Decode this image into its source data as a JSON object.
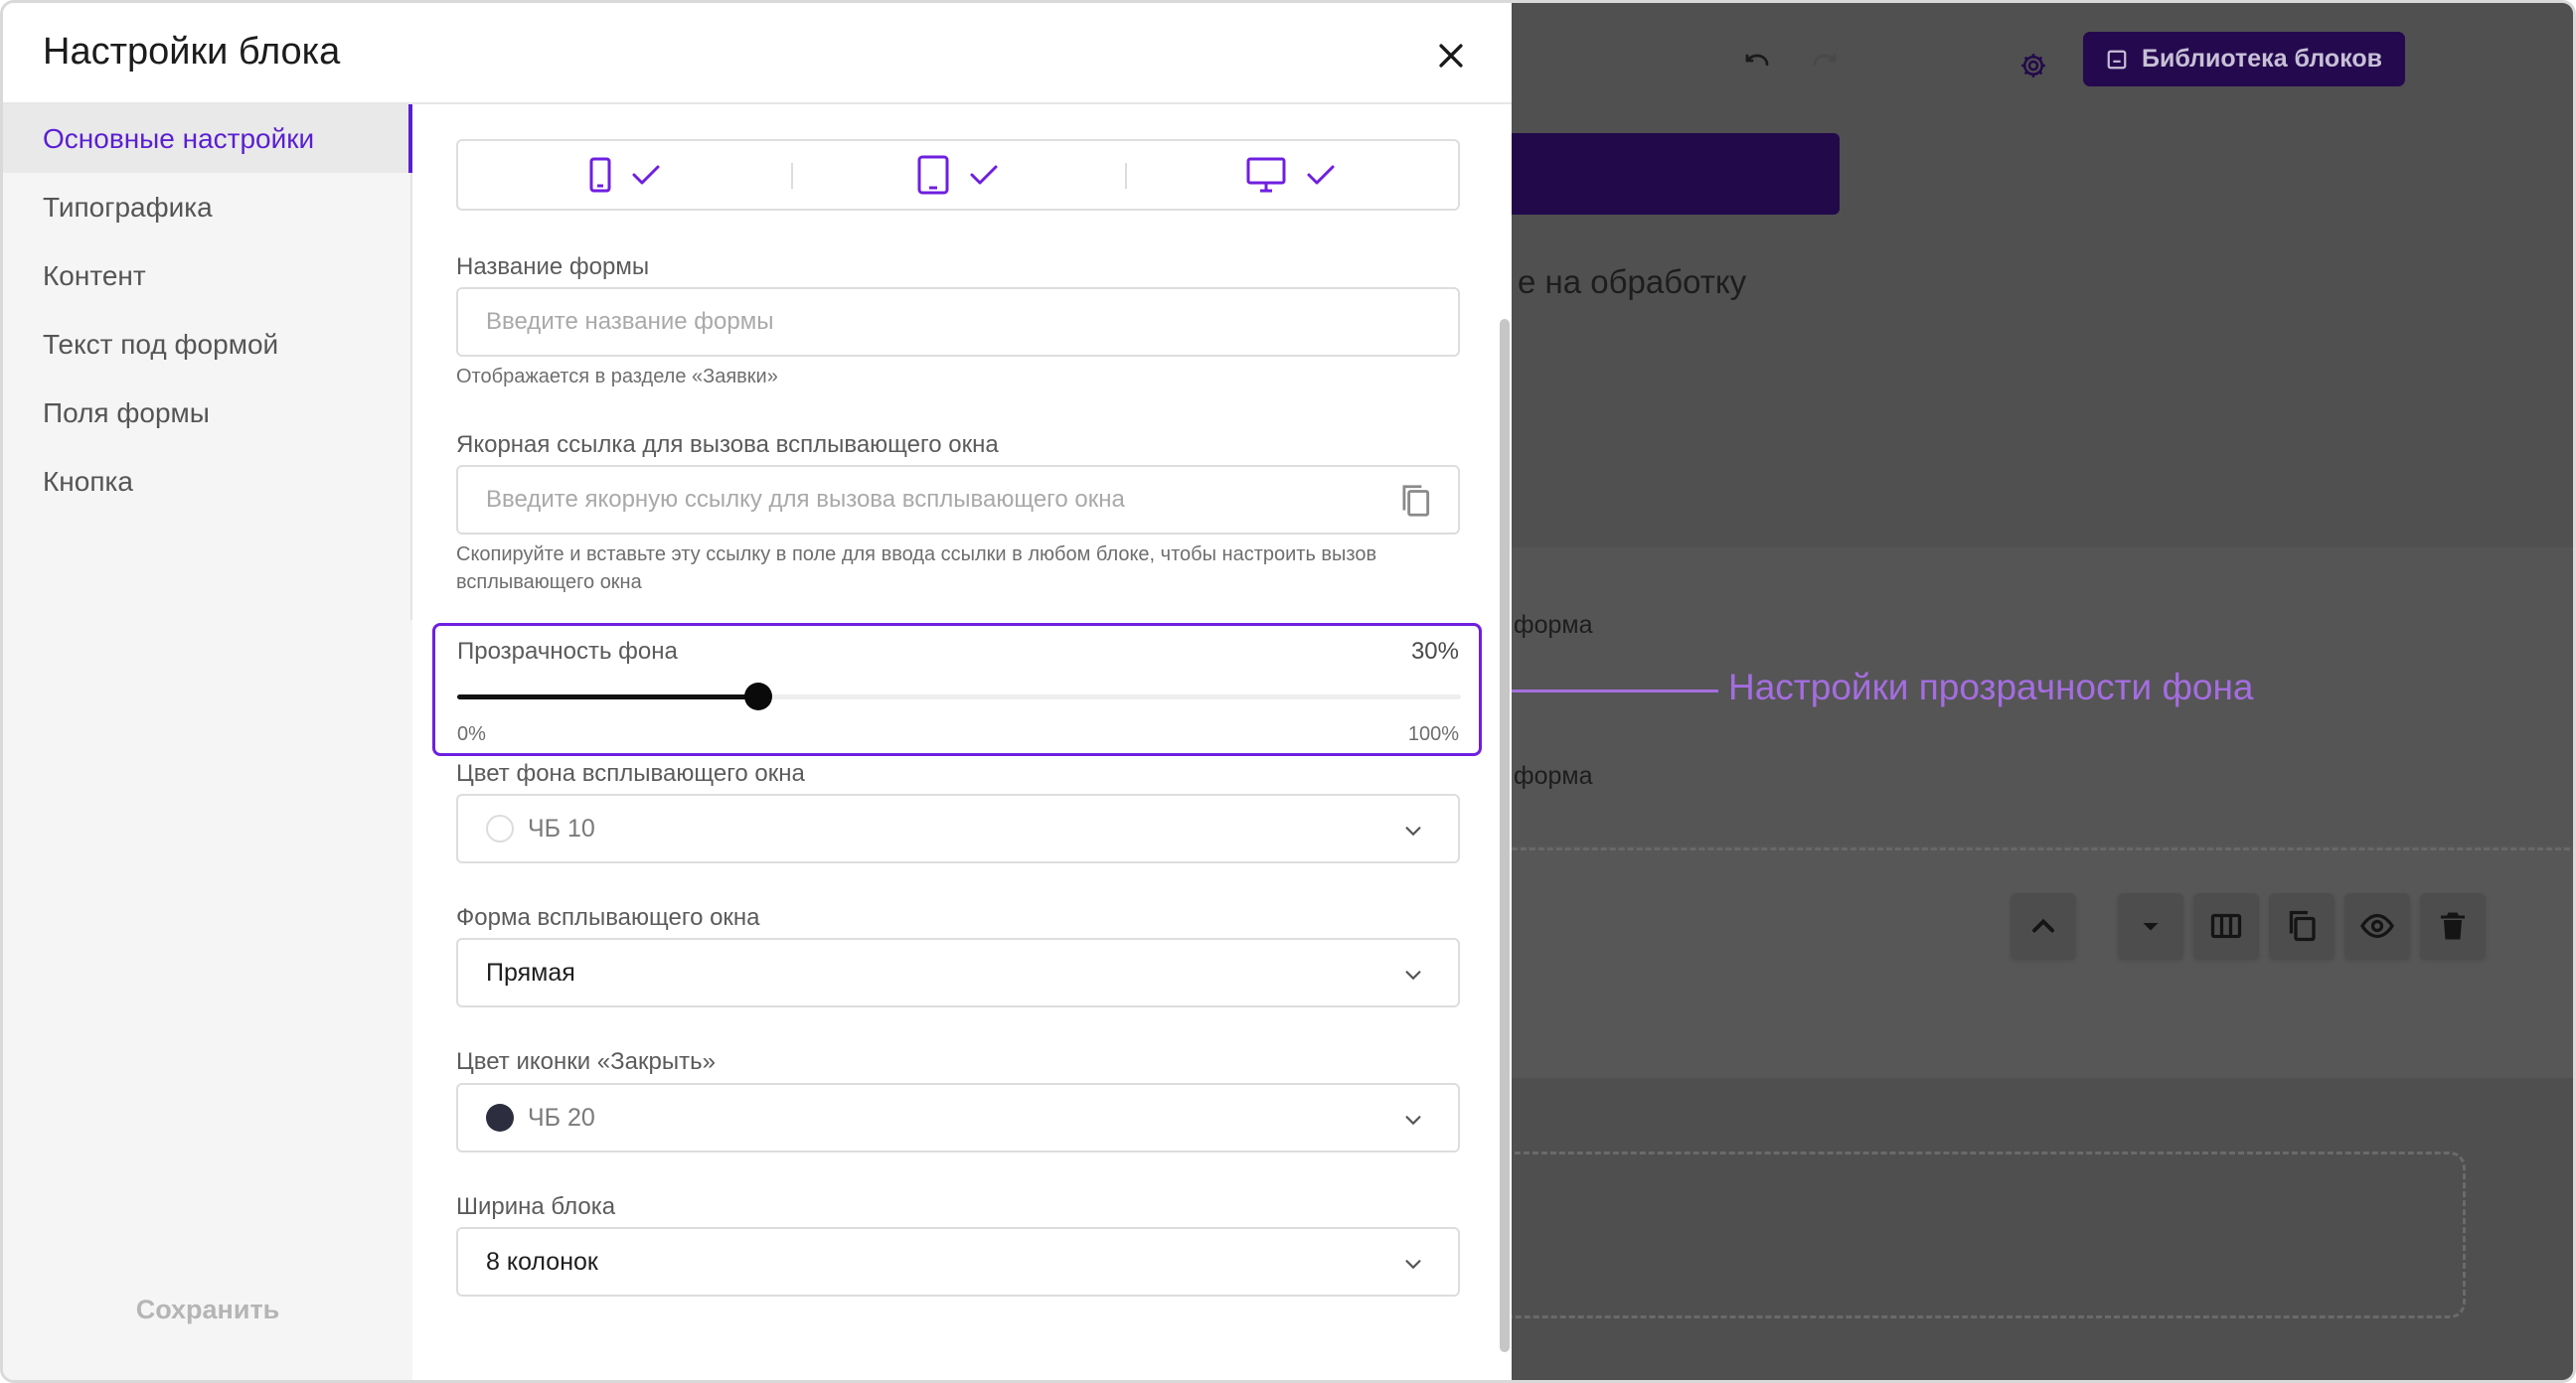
{
  "modal": {
    "title": "Настройки блока",
    "nav": [
      {
        "label": "Основные настройки",
        "active": true
      },
      {
        "label": "Типографика",
        "active": false
      },
      {
        "label": "Контент",
        "active": false
      },
      {
        "label": "Текст под формой",
        "active": false
      },
      {
        "label": "Поля формы",
        "active": false
      },
      {
        "label": "Кнопка",
        "active": false
      }
    ],
    "save_label": "Сохранить"
  },
  "devices": {
    "mobile_icon": "mobile-icon",
    "tablet_icon": "tablet-icon",
    "desktop_icon": "desktop-icon",
    "check_icon": "check-icon"
  },
  "form_name": {
    "label": "Название формы",
    "placeholder": "Введите название формы",
    "value": "",
    "hint": "Отображается в разделе «Заявки»"
  },
  "anchor": {
    "label": "Якорная ссылка для вызова всплывающего окна",
    "placeholder": "Введите якорную ссылку для вызова всплывающего окна",
    "value": "",
    "hint": "Скопируйте и вставьте эту ссылку в поле для ввода ссылки в любом блоке, чтобы настроить вызов всплывающего окна",
    "copy_icon": "copy-icon"
  },
  "opacity": {
    "label": "Прозрачность фона",
    "value": 30,
    "value_text": "30%",
    "min_text": "0%",
    "max_text": "100%"
  },
  "bg_color": {
    "label": "Цвет фона всплывающего окна",
    "value": "ЧБ 10",
    "swatch": "#ffffff"
  },
  "shape": {
    "label": "Форма всплывающего окна",
    "value": "Прямая"
  },
  "close_color": {
    "label": "Цвет иконки «Закрыть»",
    "value": "ЧБ 20",
    "swatch": "#2c2d3e"
  },
  "width": {
    "label": "Ширина блока",
    "value": "8 колонок"
  },
  "background_editor": {
    "library_button": "Библиотека блоков",
    "text_fragment": "е на обработку",
    "form_fragment_1": "форма",
    "form_fragment_2": "форма"
  },
  "callout": {
    "text": "Настройки прозрачности фона"
  },
  "colors": {
    "accent": "#5a1fd1",
    "highlight": "#6f1fe0",
    "callout": "#a46de0",
    "library_button_bg": "#25094f"
  }
}
